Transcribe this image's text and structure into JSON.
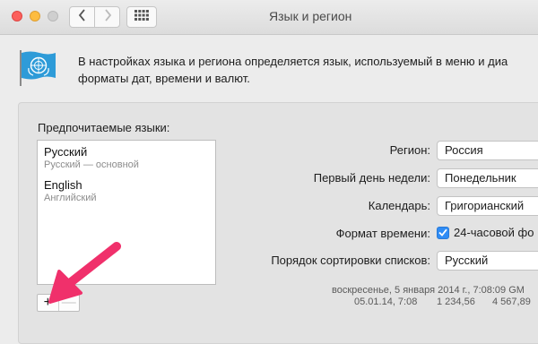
{
  "window": {
    "title": "Язык и регион"
  },
  "header": {
    "description_line1": "В настройках языка и региона определяется язык, используемый в меню и диа",
    "description_line2": "форматы дат, времени и валют."
  },
  "languages": {
    "label": "Предпочитаемые языки:",
    "items": [
      {
        "name": "Русский",
        "detail": "Русский — основной"
      },
      {
        "name": "English",
        "detail": "Английский"
      }
    ],
    "add_label": "+",
    "remove_label": "—"
  },
  "settings": {
    "region": {
      "label": "Регион:",
      "value": "Россия"
    },
    "first_day": {
      "label": "Первый день недели:",
      "value": "Понедельник"
    },
    "calendar": {
      "label": "Календарь:",
      "value": "Григорианский"
    },
    "time_format": {
      "label": "Формат времени:",
      "checkbox_label": "24-часовой фо",
      "checked": true
    },
    "sort_order": {
      "label": "Порядок сортировки списков:",
      "value": "Русский"
    }
  },
  "samples": {
    "line1": "воскресенье, 5 января 2014 г., 7:08:09 GM",
    "line2_date": "05.01.14, 7:08",
    "line2_number": "1 234,56",
    "line2_currency": "4 567,89"
  },
  "icons": {
    "flag": "un-flag-icon",
    "back": "chevron-left-icon",
    "forward": "chevron-right-icon",
    "show_all": "grid-icon",
    "annotation": "pink-arrow"
  },
  "colors": {
    "accent": "#2f8cf5",
    "annotation_arrow": "#f0306b",
    "close": "#fc605c",
    "minimize": "#fdbc40"
  }
}
